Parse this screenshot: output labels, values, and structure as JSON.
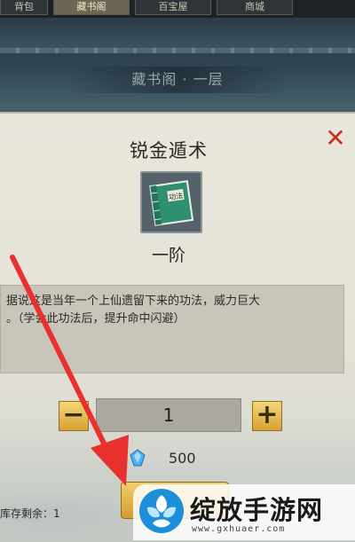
{
  "top_tabs": [
    {
      "label": "背包"
    },
    {
      "label": "藏书阁"
    },
    {
      "label": "百宝屋"
    },
    {
      "label": "商城"
    }
  ],
  "location": "藏书阁 · 一层",
  "dialog": {
    "title": "锐金遁术",
    "book_icon": "green-skill-book-icon",
    "book_cover_text": "功法",
    "tier": "一阶",
    "description_line1": "据说这是当年一个上仙遗留下来的功法，威力巨大",
    "description_line2": "。（学会此功法后，提升命中闪避）",
    "quantity": "1",
    "minus_label": "−",
    "plus_label": "+",
    "cost_icon": "blue-gem-icon",
    "cost": "500",
    "stock_label": "库存剩余：1",
    "close_label": "✕"
  },
  "annotation": {
    "type": "red-arrow",
    "color": "#e8302c"
  },
  "watermark": {
    "name": "绽放手游网",
    "url": "www.gxhuaer.com",
    "logo_icon": "blue-flower-logo"
  },
  "colors": {
    "accent_gold": "#d7a233",
    "close_red": "#c2341f",
    "book_green": "#3a9b7c"
  }
}
